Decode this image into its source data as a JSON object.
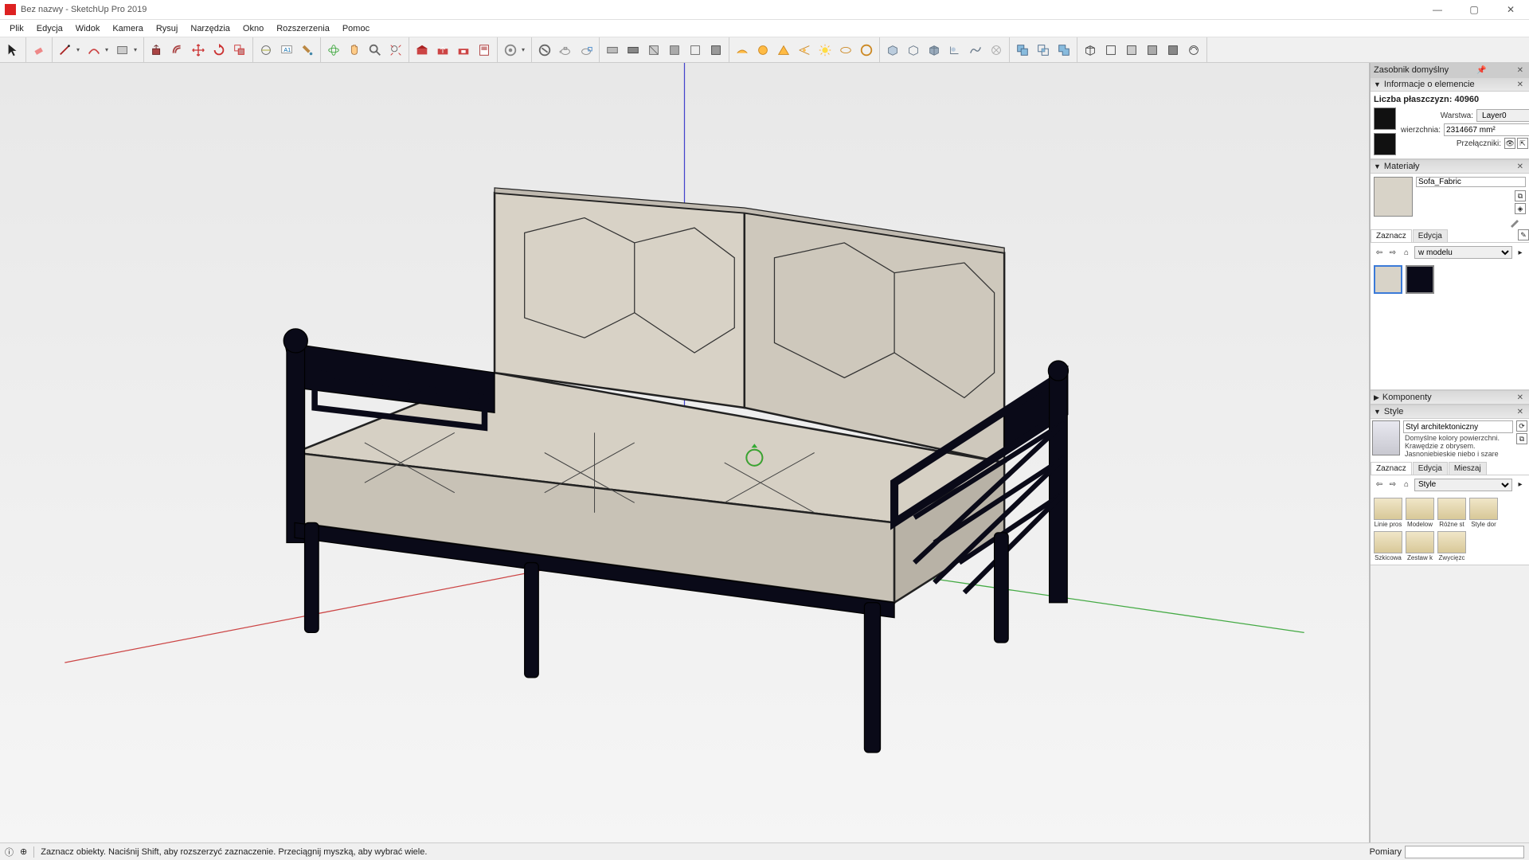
{
  "titlebar": {
    "title": "Bez nazwy - SketchUp Pro 2019"
  },
  "menu": [
    "Plik",
    "Edycja",
    "Widok",
    "Kamera",
    "Rysuj",
    "Narzędzia",
    "Okno",
    "Rozszerzenia",
    "Pomoc"
  ],
  "panels": {
    "tray_title": "Zasobnik domyślny",
    "entity_info": {
      "title": "Informacje o elemencie",
      "count_line": "Liczba płaszczyzn: 40960",
      "layer_lbl": "Warstwa:",
      "layer_val": "Layer0",
      "area_lbl": "wierzchnia:",
      "area_val": "2314667 mm²",
      "toggles_lbl": "Przełączniki:"
    },
    "materials": {
      "title": "Materiały",
      "name": "Sofa_Fabric",
      "tab_select": "Zaznacz",
      "tab_edit": "Edycja",
      "scope": "w modelu"
    },
    "components": {
      "title": "Komponenty"
    },
    "styles": {
      "title": "Style",
      "name": "Styl architektoniczny",
      "desc": "Domyślne kolory powierzchni. Krawędzie z obrysem. Jasnoniebieskie niebo i szare",
      "tab_select": "Zaznacz",
      "tab_edit": "Edycja",
      "tab_mix": "Mieszaj",
      "scope": "Style",
      "folders": [
        "Linie pros",
        "Modelow",
        "Różne st",
        "Style dor",
        "Szkicowa",
        "Zestaw k",
        "Zwycięzc"
      ]
    }
  },
  "statusbar": {
    "hint": "Zaznacz obiekty. Naciśnij Shift, aby rozszerzyć zaznaczenie. Przeciągnij myszką, aby wybrać wiele.",
    "measure_lbl": "Pomiary"
  }
}
